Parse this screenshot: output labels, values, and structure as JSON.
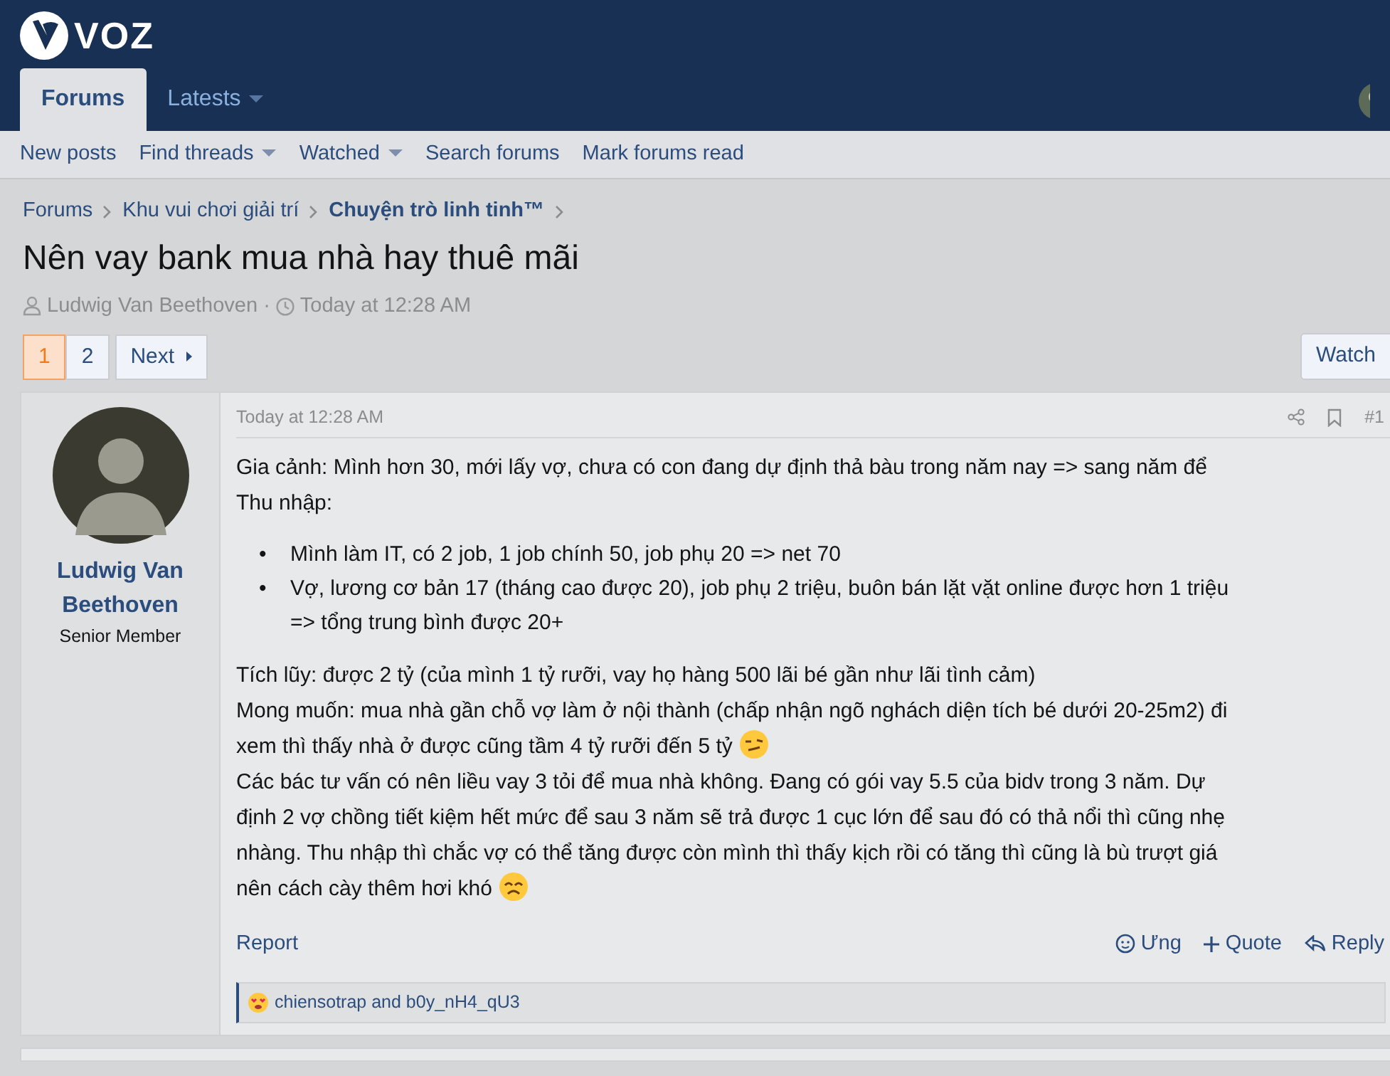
{
  "header": {
    "logo_text": "VOZ"
  },
  "nav_tabs": [
    {
      "label": "Forums",
      "selected": true,
      "dropdown": false
    },
    {
      "label": "Latests",
      "selected": false,
      "dropdown": true
    }
  ],
  "sub_nav": [
    {
      "label": "New posts",
      "dropdown": false
    },
    {
      "label": "Find threads",
      "dropdown": true
    },
    {
      "label": "Watched",
      "dropdown": true
    },
    {
      "label": "Search forums",
      "dropdown": false
    },
    {
      "label": "Mark forums read",
      "dropdown": false
    }
  ],
  "breadcrumbs": [
    {
      "label": "Forums",
      "current": false
    },
    {
      "label": "Khu vui chơi giải trí",
      "current": false
    },
    {
      "label": "Chuyện trò linh tinh™",
      "current": true
    }
  ],
  "thread": {
    "title": "Nên vay bank mua nhà hay thuê mãi",
    "author": "Ludwig Van Beethoven",
    "separator": "·",
    "time": "Today at 12:28 AM"
  },
  "pagination": {
    "pages": [
      {
        "label": "1",
        "selected": true
      },
      {
        "label": "2",
        "selected": false
      }
    ],
    "next": "Next"
  },
  "watch_button": "Watch",
  "post": {
    "time": "Today at 12:28 AM",
    "number": "#1",
    "user": {
      "name": "Ludwig Van Beethoven",
      "title": "Senior Member"
    },
    "blocks": [
      {
        "kind": "text",
        "lines": [
          {
            "kind": "plain",
            "text": "Gia cảnh: Mình hơn 30, mới lấy vợ, chưa có con đang dự định thả bàu trong năm nay => sang năm để"
          },
          {
            "kind": "plain",
            "text": "Thu nhập:"
          }
        ]
      },
      {
        "kind": "list",
        "marker": "•",
        "items": [
          {
            "lines": [
              {
                "kind": "plain",
                "text": "Mình làm IT, có 2 job, 1 job chính 50, job phụ 20 => net 70"
              }
            ]
          },
          {
            "lines": [
              {
                "kind": "plain",
                "text": "Vợ, lương cơ bản 17 (tháng cao được 20), job phụ 2 triệu, buôn bán lặt vặt online được hơn 1 triệu"
              },
              {
                "kind": "plain",
                "text": "=> tổng trung bình được 20+"
              }
            ]
          }
        ]
      },
      {
        "kind": "text",
        "lines": [
          {
            "kind": "plain",
            "text": "Tích lũy: được 2 tỷ (của mình 1 tỷ rưỡi, vay họ hàng 500 lãi bé gần như lãi tình cảm)"
          },
          {
            "kind": "plain",
            "text": "Mong muốn: mua nhà gần chỗ vợ làm ở nội thành (chấp nhận ngõ nghách diện tích bé dưới 20-25m2) đi"
          },
          {
            "kind": "smirk",
            "text": "xem thì thấy nhà ở được cũng tầm 4 tỷ rưỡi đến 5 tỷ"
          },
          {
            "kind": "plain",
            "text": "Các bác tư vấn có nên liều vay 3 tỏi để mua nhà không. Đang có gói vay 5.5 của bidv trong 3 năm. Dự"
          },
          {
            "kind": "plain",
            "text": "định 2 vợ chồng tiết kiệm hết mức để sau 3 năm sẽ trả được 1 cục lớn để sau đó có thả nổi thì cũng nhẹ"
          },
          {
            "kind": "plain",
            "text": "nhàng. Thu nhập thì chắc vợ có thể tăng được còn mình thì thấy kịch rồi có tăng thì cũng là bù trượt giá"
          },
          {
            "kind": "worried",
            "text": "nên cách cày thêm hơi khó"
          }
        ]
      }
    ],
    "report": "Report",
    "actions": [
      {
        "kind": "react",
        "label": "Ưng"
      },
      {
        "kind": "quote",
        "label": "Quote"
      },
      {
        "kind": "reply",
        "label": "Reply"
      }
    ],
    "reactions": "chiensotrap and b0y_nH4_qU3"
  }
}
